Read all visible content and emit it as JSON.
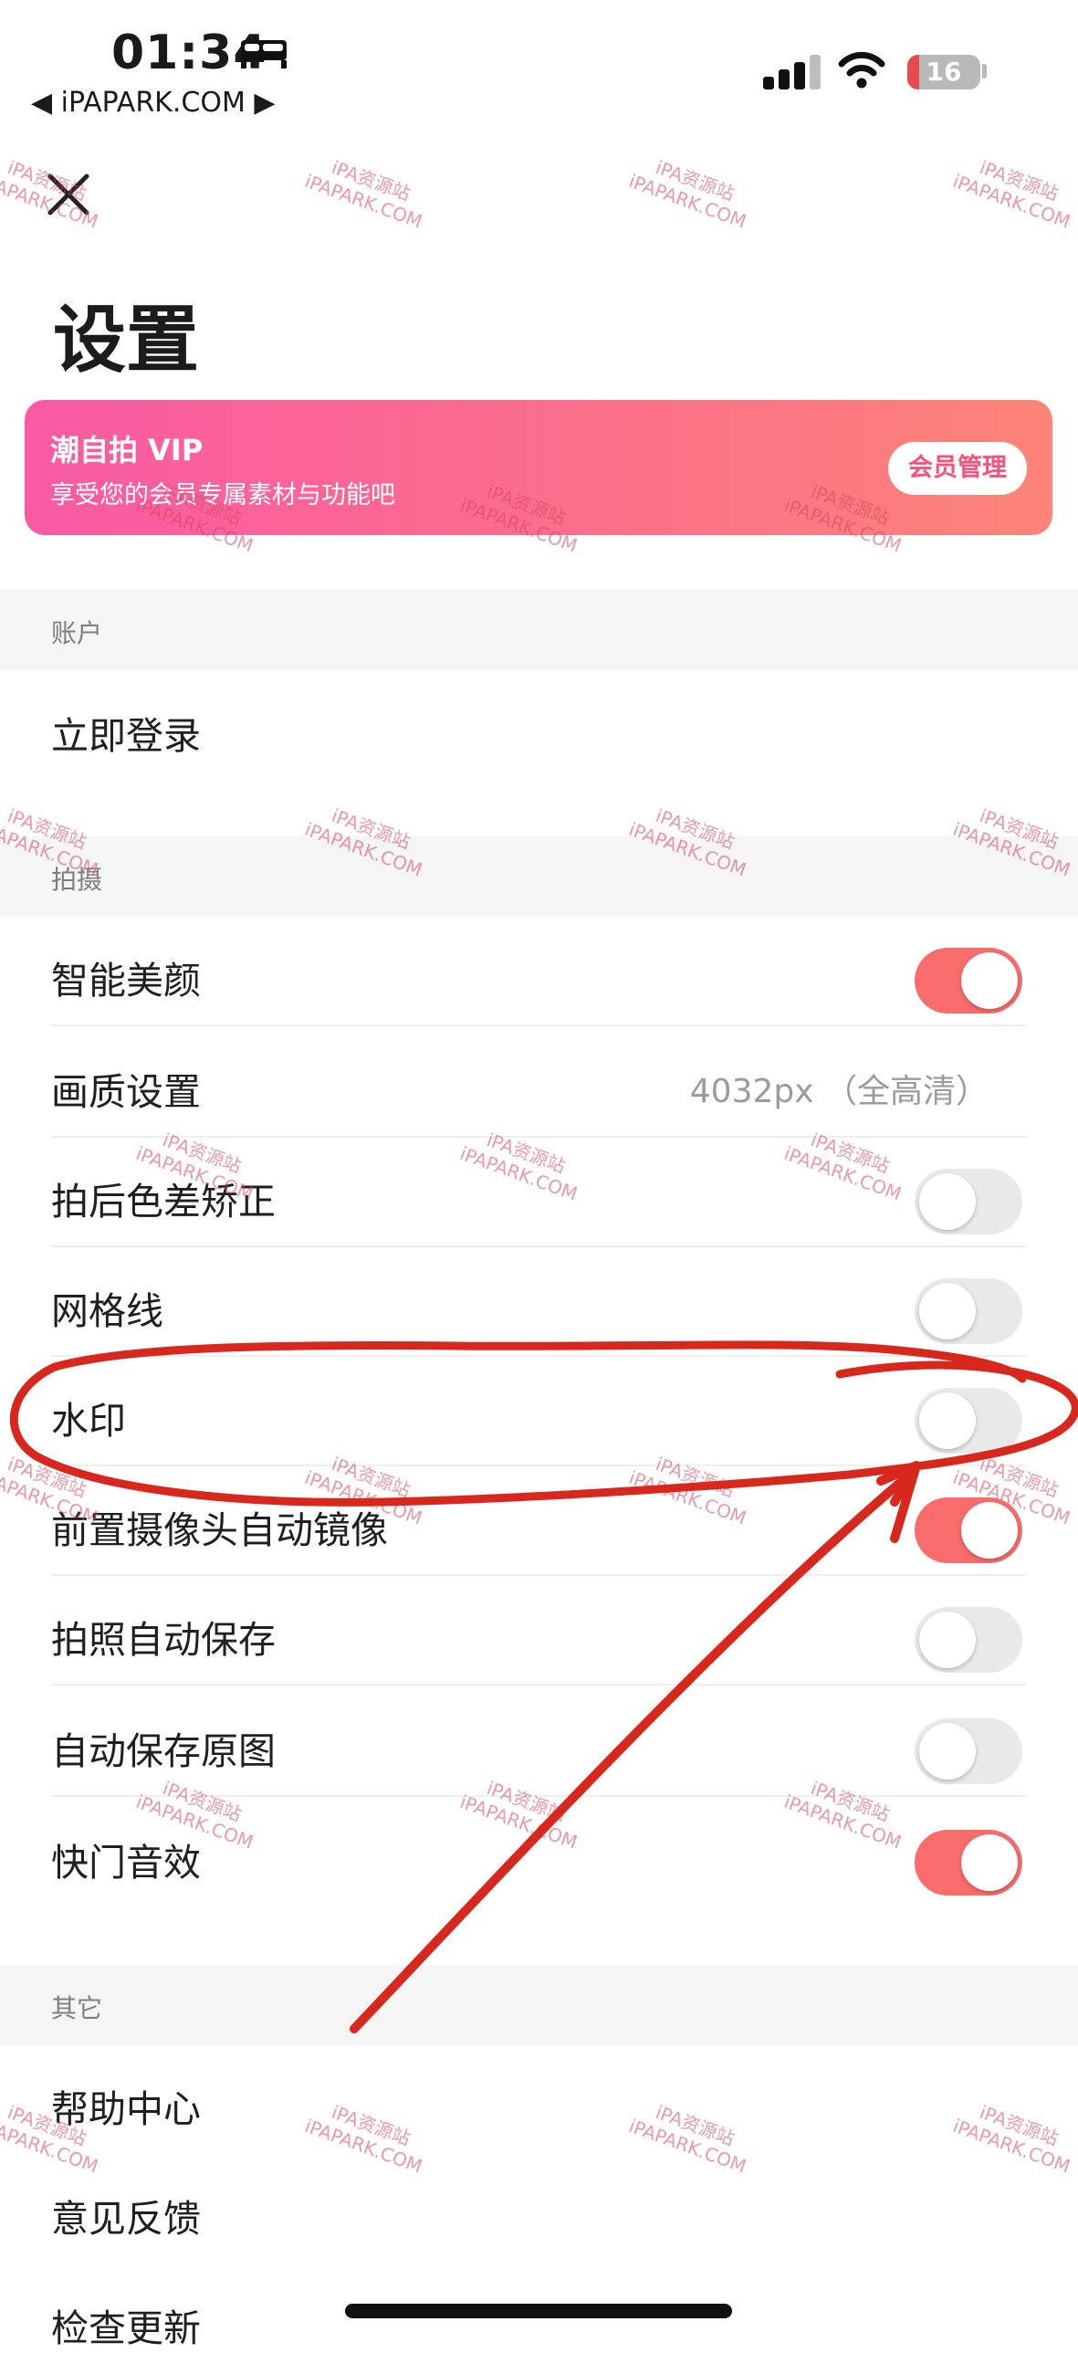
{
  "status_bar": {
    "time": "01:34",
    "back_app": "◀ iPAPARK.COM ▶",
    "battery": "16",
    "battery_level": 0.16,
    "icons": [
      "bed-icon",
      "signal-icon",
      "wifi-icon",
      "battery-icon"
    ]
  },
  "header": {
    "title": "设置",
    "close_icon": "close-icon"
  },
  "vip_banner": {
    "title": "潮自拍 VIP",
    "subtitle": "享受您的会员专属素材与功能吧",
    "button": "会员管理"
  },
  "sections": {
    "account": {
      "title": "账户",
      "items": [
        {
          "label": "立即登录"
        }
      ]
    },
    "shooting": {
      "title": "拍摄",
      "items": [
        {
          "label": "智能美颜",
          "toggle": true
        },
        {
          "label": "画质设置",
          "value": "4032px （全高清）"
        },
        {
          "label": "拍后色差矫正",
          "toggle": false
        },
        {
          "label": "网格线",
          "toggle": false
        },
        {
          "label": "水印",
          "toggle": false
        },
        {
          "label": "前置摄像头自动镜像",
          "toggle": true
        },
        {
          "label": "拍照自动保存",
          "toggle": false
        },
        {
          "label": "自动保存原图",
          "toggle": false
        },
        {
          "label": "快门音效",
          "toggle": true
        }
      ]
    },
    "other": {
      "title": "其它",
      "items": [
        {
          "label": "帮助中心"
        },
        {
          "label": "意见反馈"
        },
        {
          "label": "检查更新"
        }
      ]
    }
  },
  "watermark": {
    "line1": "iPA资源站",
    "line2": "iPAPARK.COM"
  },
  "colors": {
    "accent": "#f86c6c",
    "annotation": "#d8281e"
  }
}
